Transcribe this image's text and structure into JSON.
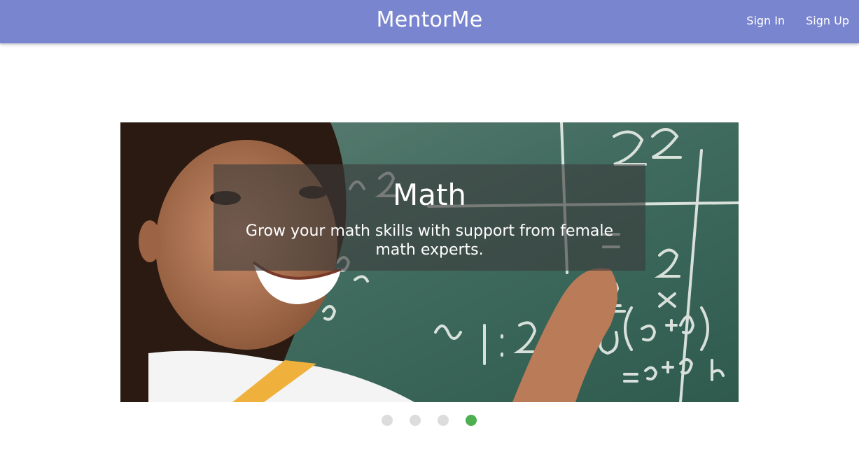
{
  "header": {
    "brand": "MentorMe",
    "sign_in_label": "Sign In",
    "sign_up_label": "Sign Up",
    "background_color": "#7a85cf"
  },
  "carousel": {
    "slide_title": "Math",
    "slide_text": "Grow your math skills with support from female math experts.",
    "indicators": [
      {
        "active": false
      },
      {
        "active": false
      },
      {
        "active": false
      },
      {
        "active": true
      }
    ],
    "active_indicator_color": "#4caf50",
    "inactive_indicator_color": "#dcdcdc"
  }
}
